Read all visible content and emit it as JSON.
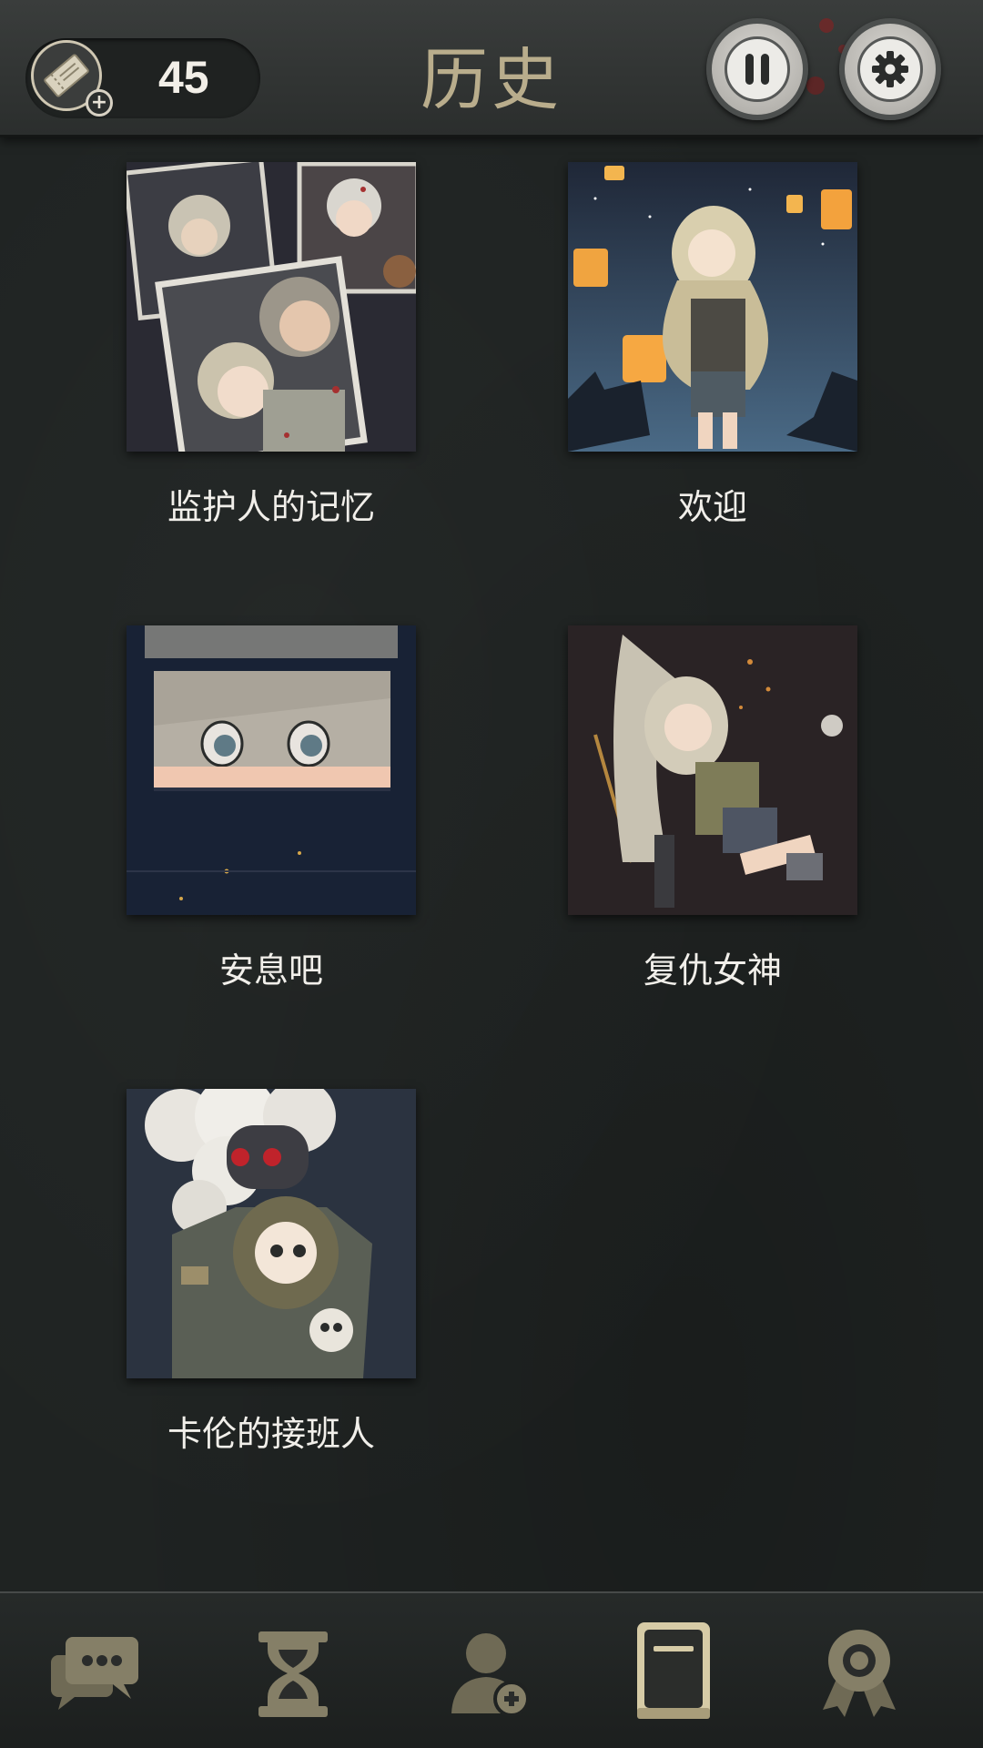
{
  "header": {
    "ticket_count": "45",
    "title": "历史"
  },
  "gallery": {
    "items": [
      {
        "caption": "监护人的记忆"
      },
      {
        "caption": "欢迎"
      },
      {
        "caption": "安息吧"
      },
      {
        "caption": "复仇女神"
      },
      {
        "caption": "卡伦的接班人"
      }
    ]
  },
  "nav": {
    "items": [
      {
        "icon": "chat-bubbles-icon",
        "active": false
      },
      {
        "icon": "hourglass-icon",
        "active": false
      },
      {
        "icon": "add-friend-icon",
        "active": false
      },
      {
        "icon": "book-icon",
        "active": true
      },
      {
        "icon": "medal-icon",
        "active": false
      }
    ]
  },
  "colors": {
    "accent": "#c9bd98",
    "inactive_icon": "#7b7764",
    "background": "#1f2322"
  }
}
